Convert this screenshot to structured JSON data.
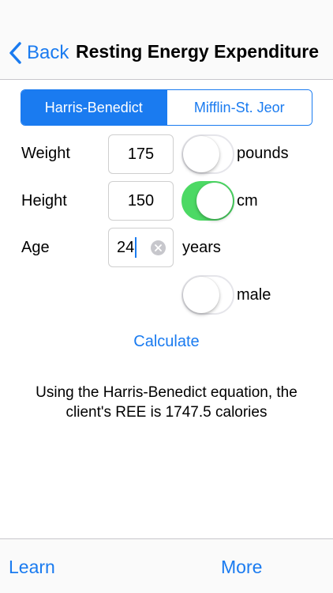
{
  "nav": {
    "back_label": "Back",
    "title": "Resting Energy Expenditure"
  },
  "segments": [
    "Harris-Benedict",
    "Mifflin-St. Jeor"
  ],
  "selected_segment": "Harris-Benedict",
  "form": {
    "weight": {
      "label": "Weight",
      "value": "175",
      "unit_switch_on": false,
      "unit_label": "pounds"
    },
    "height": {
      "label": "Height",
      "value": "150",
      "unit_switch_on": true,
      "unit_label": "cm"
    },
    "age": {
      "label": "Age",
      "value": "24",
      "unit_label": "years"
    },
    "sex": {
      "switch_on": false,
      "label": "male"
    }
  },
  "calculate_label": "Calculate",
  "result": {
    "line1": "Using the Harris-Benedict equation, the",
    "line2": "client's REE is 1747.5 calories"
  },
  "tabs": {
    "learn": "Learn",
    "more": "More"
  },
  "colors": {
    "accent": "#1a7bf0",
    "switch_on": "#4cd964",
    "clear_button": "#c7c7cc"
  }
}
